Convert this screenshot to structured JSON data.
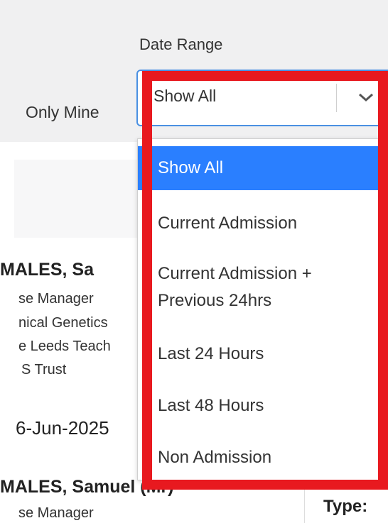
{
  "filters": {
    "date_range_label": "Date Range",
    "only_mine_label": "Only Mine",
    "date_range_value": "Show All"
  },
  "dropdown": {
    "options": [
      {
        "label": "Show All",
        "selected": true
      },
      {
        "label": "Current Admission"
      },
      {
        "label": "Current Admission +"
      },
      {
        "label": "Previous 24hrs"
      },
      {
        "label": "Last 24 Hours"
      },
      {
        "label": "Last 48 Hours"
      },
      {
        "label": "Non Admission"
      }
    ]
  },
  "list": {
    "items": [
      {
        "name": "MALES, Sa",
        "role": "se Manager",
        "dept": "nical Genetics",
        "org1": "e Leeds Teach",
        "org2": "S Trust",
        "date": "6-Jun-2025"
      },
      {
        "name": "MALES, Samuel (Mr)",
        "role": "se Manager"
      }
    ]
  },
  "detail": {
    "type_label": "Type:"
  },
  "colors": {
    "accent": "#2a7fff",
    "highlight": "#e8191f",
    "focus_border": "#4a90e2"
  }
}
